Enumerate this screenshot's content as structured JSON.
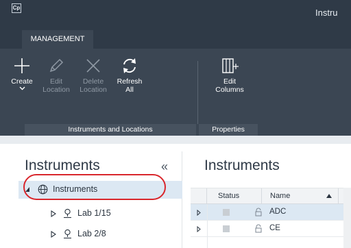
{
  "window": {
    "app_logo": "Cp",
    "title": "Instru"
  },
  "ribbon": {
    "tab": "MANAGEMENT",
    "buttons": [
      {
        "id": "create",
        "label": "Create",
        "icon": "plus-icon",
        "enabled": true,
        "has_dropdown": true
      },
      {
        "id": "edit-location",
        "label": "Edit\nLocation",
        "icon": "pencil-icon",
        "enabled": false
      },
      {
        "id": "delete-location",
        "label": "Delete\nLocation",
        "icon": "x-icon",
        "enabled": false
      },
      {
        "id": "refresh-all",
        "label": "Refresh\nAll",
        "icon": "refresh-icon",
        "enabled": true
      },
      {
        "id": "edit-columns",
        "label": "Edit\nColumns",
        "icon": "columns-icon",
        "enabled": true
      }
    ],
    "groups": [
      {
        "label": "Instruments and Locations"
      },
      {
        "label": "Properties"
      }
    ]
  },
  "left_panel": {
    "title": "Instruments",
    "collapse_glyph": "«",
    "tree": [
      {
        "label": "Instruments",
        "icon": "globe-icon",
        "expanded": true,
        "selected": true
      },
      {
        "label": "Lab 1/15",
        "icon": "location-pin-icon",
        "expanded": false,
        "selected": false
      },
      {
        "label": "Lab 2/8",
        "icon": "location-pin-icon",
        "expanded": false,
        "selected": false
      }
    ]
  },
  "right_panel": {
    "title": "Instruments",
    "columns": [
      "Status",
      "Name"
    ],
    "sort": {
      "column": "Name",
      "direction": "ascending"
    },
    "rows": [
      {
        "name": "ADC",
        "selected": true
      },
      {
        "name": "CE",
        "selected": false
      }
    ]
  },
  "colors": {
    "titlebar": "#2f3a47",
    "ribbon": "#3b4653",
    "selection": "#dce8f3",
    "highlight_annotation": "#d9262c"
  }
}
